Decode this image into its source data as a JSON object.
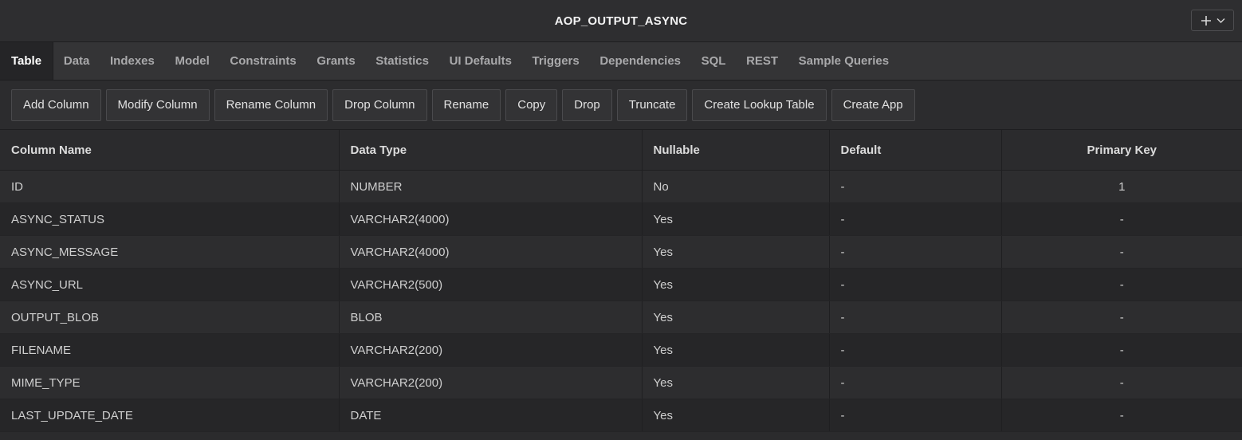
{
  "window": {
    "title": "AOP_OUTPUT_ASYNC",
    "add_icon": "plus-icon",
    "menu_icon": "chevron-down-icon"
  },
  "tabs": [
    {
      "label": "Table",
      "active": true
    },
    {
      "label": "Data"
    },
    {
      "label": "Indexes"
    },
    {
      "label": "Model"
    },
    {
      "label": "Constraints"
    },
    {
      "label": "Grants"
    },
    {
      "label": "Statistics"
    },
    {
      "label": "UI Defaults"
    },
    {
      "label": "Triggers"
    },
    {
      "label": "Dependencies"
    },
    {
      "label": "SQL"
    },
    {
      "label": "REST"
    },
    {
      "label": "Sample Queries"
    }
  ],
  "toolbar": [
    "Add Column",
    "Modify Column",
    "Rename Column",
    "Drop Column",
    "Rename",
    "Copy",
    "Drop",
    "Truncate",
    "Create Lookup Table",
    "Create App"
  ],
  "table": {
    "headers": [
      "Column Name",
      "Data Type",
      "Nullable",
      "Default",
      "Primary Key"
    ],
    "rows": [
      [
        "ID",
        "NUMBER",
        "No",
        "-",
        "1"
      ],
      [
        "ASYNC_STATUS",
        "VARCHAR2(4000)",
        "Yes",
        "-",
        "-"
      ],
      [
        "ASYNC_MESSAGE",
        "VARCHAR2(4000)",
        "Yes",
        "-",
        "-"
      ],
      [
        "ASYNC_URL",
        "VARCHAR2(500)",
        "Yes",
        "-",
        "-"
      ],
      [
        "OUTPUT_BLOB",
        "BLOB",
        "Yes",
        "-",
        "-"
      ],
      [
        "FILENAME",
        "VARCHAR2(200)",
        "Yes",
        "-",
        "-"
      ],
      [
        "MIME_TYPE",
        "VARCHAR2(200)",
        "Yes",
        "-",
        "-"
      ],
      [
        "LAST_UPDATE_DATE",
        "DATE",
        "Yes",
        "-",
        "-"
      ]
    ]
  },
  "colors": {
    "background": "#2b2b2d",
    "text": "#d6d6d6",
    "active_tab": "#252527"
  }
}
